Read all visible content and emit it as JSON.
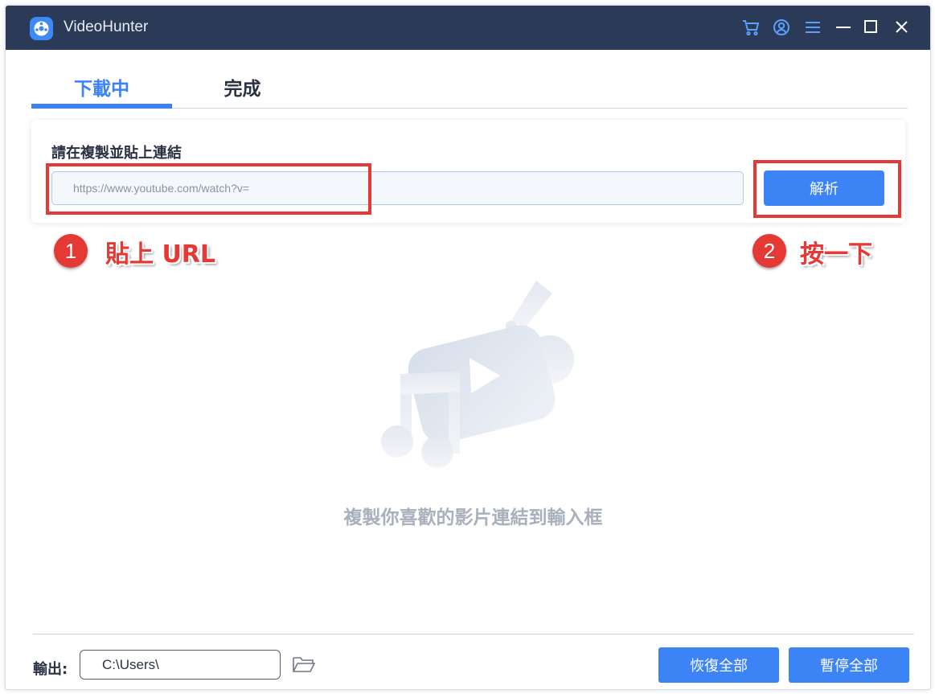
{
  "app": {
    "title": "VideoHunter"
  },
  "titlebar_icons": [
    "cart-icon",
    "account-icon",
    "menu-icon",
    "minimize-icon",
    "maximize-icon",
    "close-icon"
  ],
  "tabs": [
    {
      "label": "下載中",
      "active": true
    },
    {
      "label": "完成",
      "active": false
    }
  ],
  "url_panel": {
    "label": "請在複製並貼上連結",
    "input_value": "https://www.youtube.com/watch?v=",
    "parse_button": "解析"
  },
  "annotations": [
    {
      "number": "1",
      "text": "貼上 URL"
    },
    {
      "number": "2",
      "text": "按一下"
    }
  ],
  "empty_state": {
    "message": "複製你喜歡的影片連結到輸入框"
  },
  "footer": {
    "output_label": "輸出:",
    "output_path": "C:\\Users\\",
    "resume_all": "恢復全部",
    "pause_all": "暫停全部"
  },
  "colors": {
    "titlebar": "#2a3a57",
    "accent": "#3c83f6",
    "annotation_red": "#e53935",
    "muted_text": "#a9b0bd"
  }
}
